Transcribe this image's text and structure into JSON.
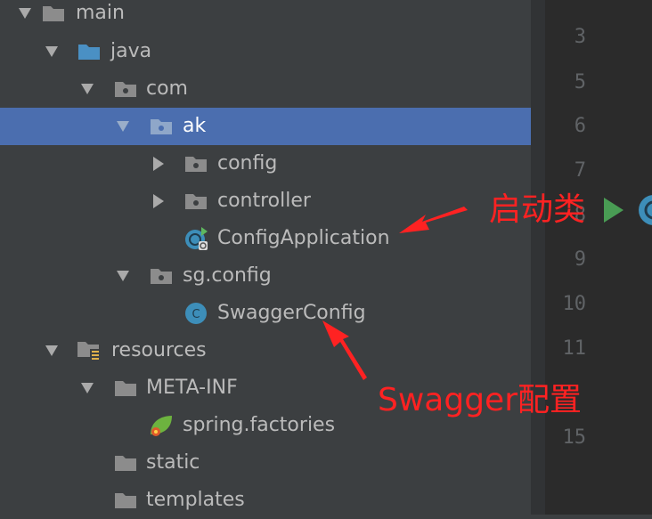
{
  "tree": {
    "rows": [
      {
        "label": "main",
        "icon": "folder-icon",
        "expander": "expanded"
      },
      {
        "label": "java",
        "icon": "source-folder-icon",
        "expander": "expanded"
      },
      {
        "label": "com",
        "icon": "package-icon",
        "expander": "expanded"
      },
      {
        "label": "ak",
        "icon": "package-icon",
        "expander": "expanded",
        "selected": true
      },
      {
        "label": "config",
        "icon": "package-icon",
        "expander": "collapsed"
      },
      {
        "label": "controller",
        "icon": "package-icon",
        "expander": "collapsed"
      },
      {
        "label": "ConfigApplication",
        "icon": "spring-boot-class-icon",
        "expander": "none"
      },
      {
        "label": "sg.config",
        "icon": "package-icon",
        "expander": "expanded"
      },
      {
        "label": "SwaggerConfig",
        "icon": "class-icon",
        "expander": "none"
      },
      {
        "label": "resources",
        "icon": "resources-folder-icon",
        "expander": "expanded"
      },
      {
        "label": "META-INF",
        "icon": "folder-icon",
        "expander": "expanded"
      },
      {
        "label": "spring.factories",
        "icon": "spring-factories-icon",
        "expander": "none"
      },
      {
        "label": "static",
        "icon": "folder-icon",
        "expander": "none"
      },
      {
        "label": "templates",
        "icon": "folder-icon",
        "expander": "none"
      }
    ]
  },
  "gutter": {
    "line_numbers": [
      "3",
      "5",
      "6",
      "7",
      "8",
      "9",
      "10",
      "11",
      "15"
    ],
    "run_icon": "run-triangle-icon"
  },
  "annotations": {
    "startup_class": "启动类",
    "swagger_config": "Swagger配置"
  },
  "colors": {
    "panel_bg": "#3c3f41",
    "selection": "#4b6eaf",
    "text": "#bbbbbb",
    "folder": "#8c8c8c",
    "source_folder": "#4a90c4",
    "class_icon": "#3d8eb9",
    "annotation": "#ff2222",
    "run": "#499c54"
  }
}
